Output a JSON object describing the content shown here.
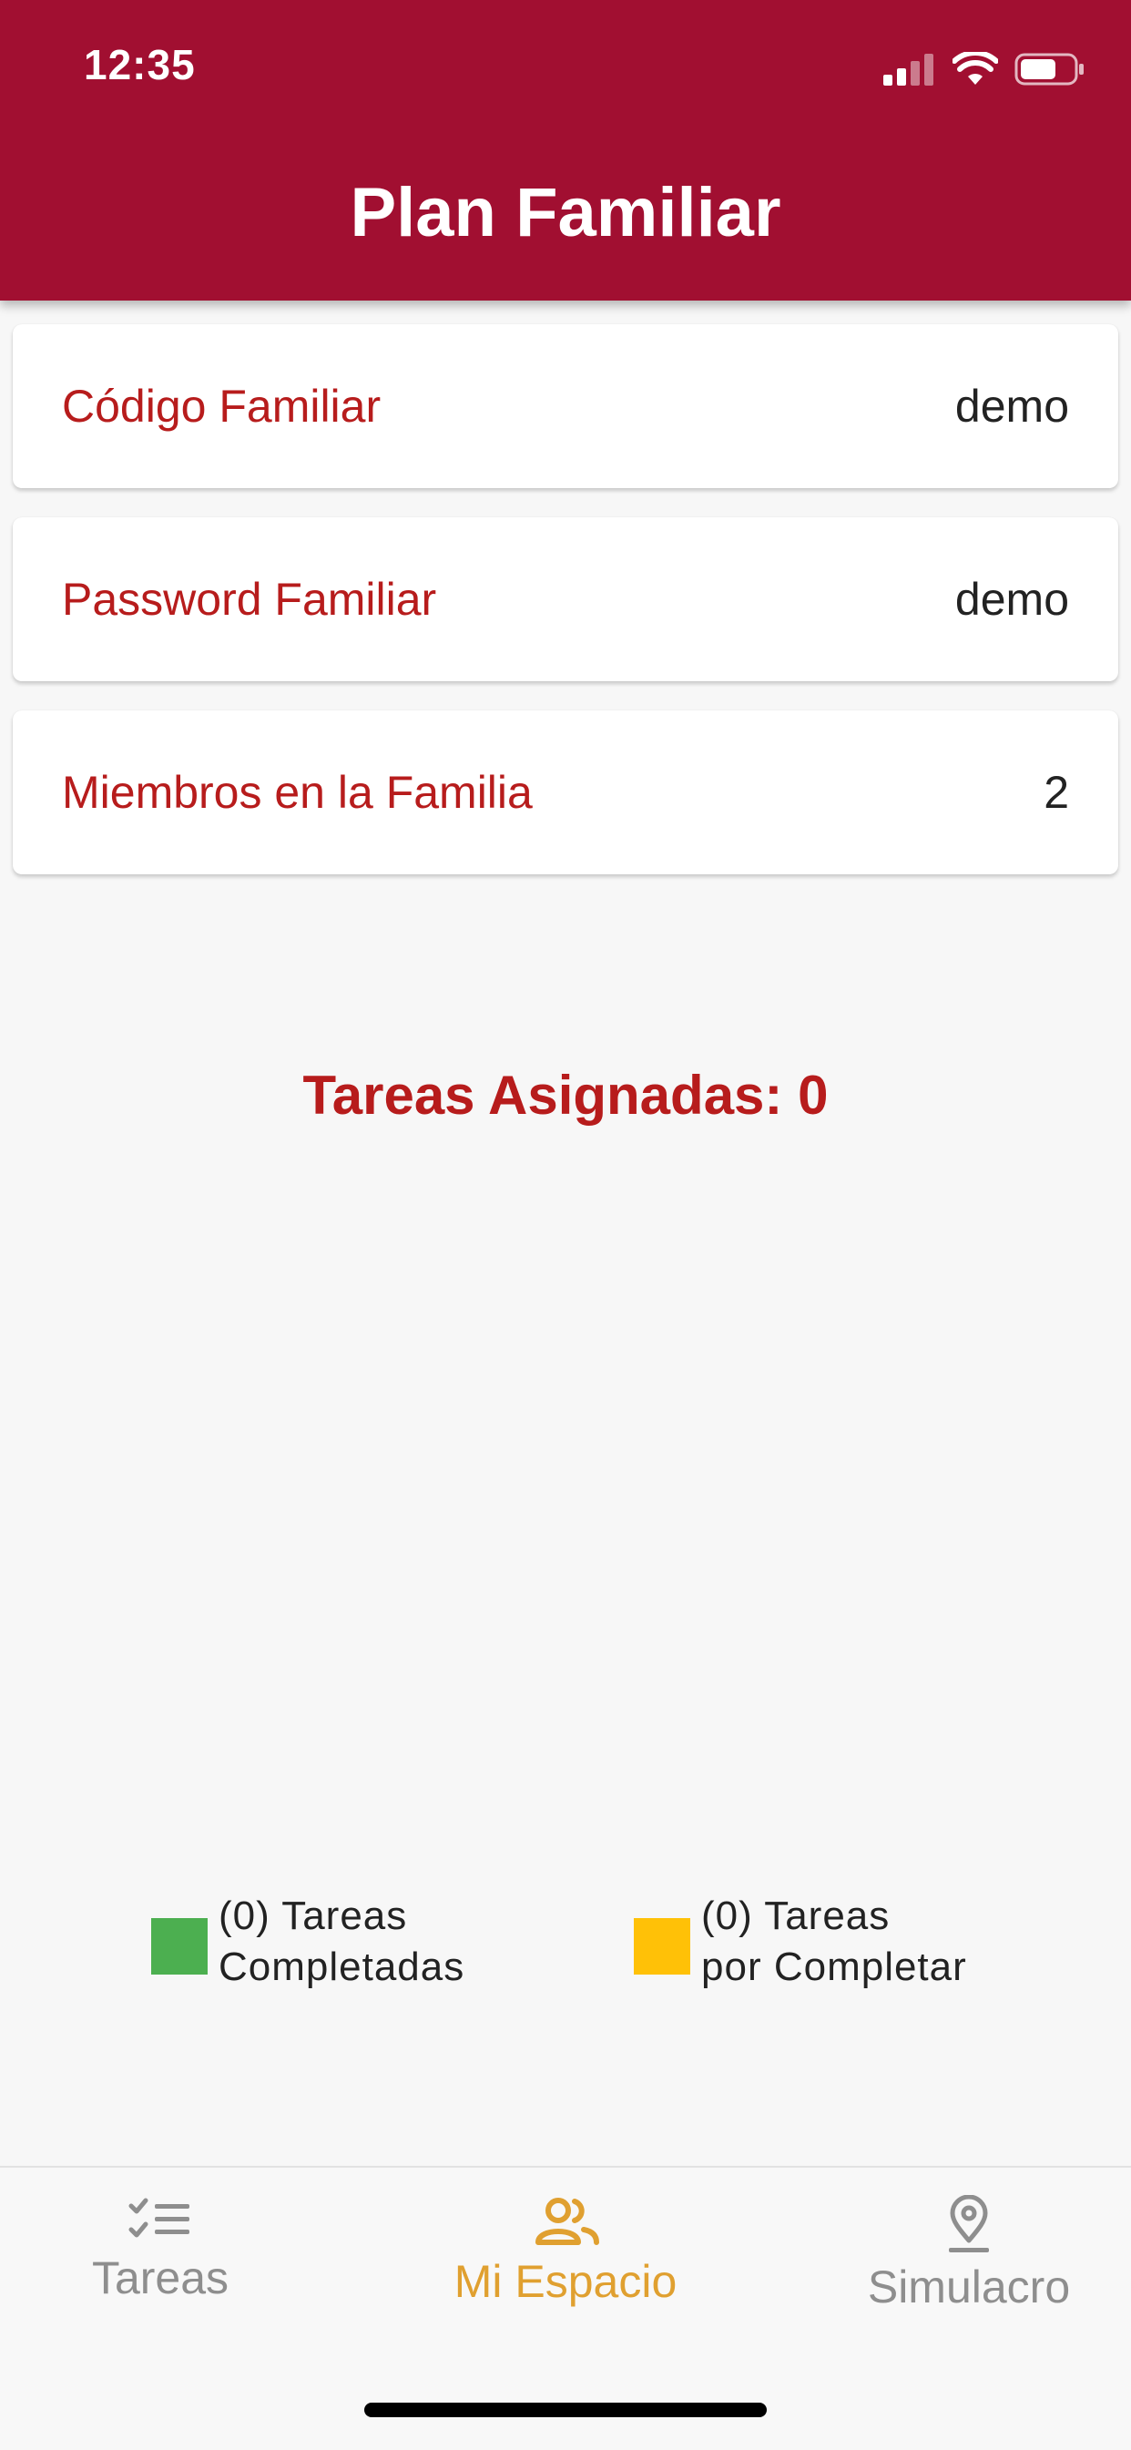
{
  "status_bar": {
    "time": "12:35"
  },
  "header": {
    "title": "Plan Familiar"
  },
  "cards": [
    {
      "label": "Código Familiar",
      "value": "demo"
    },
    {
      "label": "Password Familiar",
      "value": "demo"
    },
    {
      "label": "Miembros en la Familia",
      "value": "2"
    }
  ],
  "summary": {
    "assigned_text": "Tareas Asignadas: 0"
  },
  "legend": [
    {
      "line1": "(0) Tareas",
      "line2": "Completadas",
      "color": "#4caf50"
    },
    {
      "line1": "(0) Tareas",
      "line2": "por Completar",
      "color": "#ffc107"
    }
  ],
  "bottom_nav": {
    "items": [
      {
        "label": "Tareas",
        "icon": "task-list-icon",
        "active": false
      },
      {
        "label": "Mi Espacio",
        "icon": "people-icon",
        "active": true
      },
      {
        "label": "Simulacro",
        "icon": "location-pin-icon",
        "active": false
      }
    ],
    "active_color": "#e0a030",
    "inactive_color": "#8e8e8e"
  }
}
